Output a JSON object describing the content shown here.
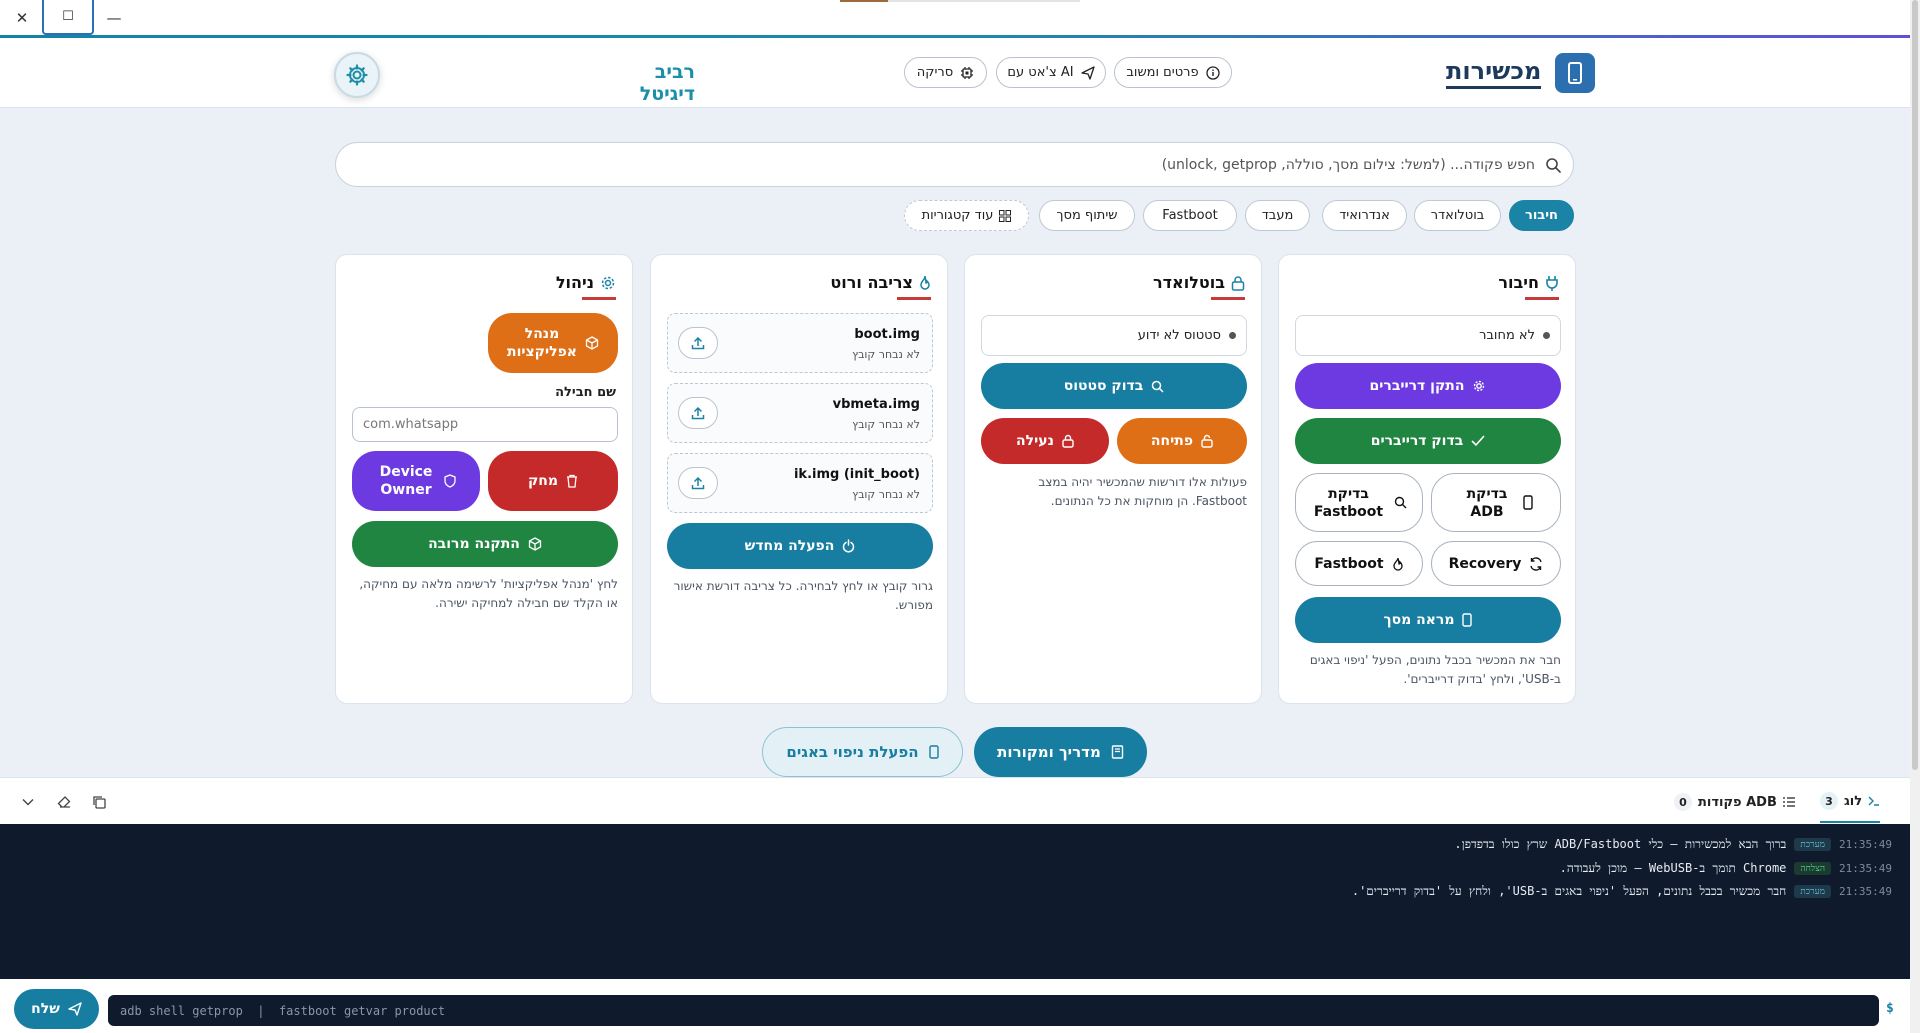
{
  "window": {
    "close": "✕",
    "maximize": "☐",
    "minimize": "—"
  },
  "header": {
    "app_name": "מכשירות",
    "nav": {
      "details": "פרטים ומשוב",
      "chat": "צ'אט עם AI",
      "scan": "סריקה"
    },
    "user_name": "רביב דיגיטל"
  },
  "search": {
    "placeholder": "חפש פקודה... (למשל: צילום מסך, סוללה, unlock, getprop)"
  },
  "categories": {
    "connect": "חיבור",
    "bootloader": "בוטלואדר",
    "android": "אנדרואיד",
    "processor": "מעבד",
    "fastboot": "Fastboot",
    "screen_share": "שיתוף מסך",
    "more": "עוד קטגוריות"
  },
  "cards": {
    "connect": {
      "title": "חיבור",
      "status": "לא מחובר",
      "install_drivers": "התקן דרייברים",
      "check_drivers": "בדוק דרייברים",
      "check_adb": "בדיקת ADB",
      "check_fastboot": "בדיקת Fastboot",
      "recovery": "Recovery",
      "fastboot": "Fastboot",
      "mirror": "מראה מסך",
      "note": "חבר את המכשיר בכבל נתונים, הפעל 'ניפוי באגים ב-USB', ולחץ 'בדוק דרייברים'."
    },
    "bootloader": {
      "title": "בוטלואדר",
      "status": "סטטוס לא ידוע",
      "check_status": "בדוק סטטוס",
      "unlock": "פתיחה",
      "lock": "נעילה",
      "note": "פעולות אלו דורשות שהמכשיר יהיה במצב Fastboot. הן מוחקות את כל הנתונים."
    },
    "flash": {
      "title": "צריבה ורוט",
      "files": [
        {
          "name": "boot.img",
          "status": "לא נבחר קובץ"
        },
        {
          "name": "vbmeta.img",
          "status": "לא נבחר קובץ"
        },
        {
          "name": "ik.img (init_boot)",
          "status": "לא נבחר קובץ"
        }
      ],
      "reboot": "הפעלה מחדש",
      "note": "גרור קובץ או לחץ לבחירה. כל צריבה דורשת אישור מפורש."
    },
    "manage": {
      "title": "ניהול",
      "app_manager": "מנהל אפליקציות",
      "package_label": "שם חבילה",
      "package_placeholder": "com.whatsapp",
      "remove": "מחק",
      "device_owner": "Device Owner",
      "bulk_install": "התקנה מרובה",
      "note": "לחץ 'מנהל אפליקציות' לרשימה מלאה עם מחיקה, או הקלד שם חבילה למחיקה ישירה."
    }
  },
  "bottom": {
    "guide": "מדריך ומקורות",
    "enable_debug": "הפעלת ניפוי באגים"
  },
  "panel": {
    "log_tab": "לוג",
    "log_count": "3",
    "adb_tab": "פקודות ADB",
    "adb_count": "0",
    "rows": [
      {
        "time": "21:35:49",
        "tag": "מערכת",
        "text": "ברוך הבא למכשירות — כלי ADB/Fastboot שרץ כולו בדפדפן."
      },
      {
        "time": "21:35:49",
        "tag": "הצלחה",
        "text": "Chrome תומך ב-WebUSB — מוכן לעבודה."
      },
      {
        "time": "21:35:49",
        "tag": "מערכת",
        "text": "חבר מכשיר בכבל נתונים, הפעל 'ניפוי באגים ב-USB', ולחץ על 'בדוק דרייברים'."
      }
    ]
  },
  "command": {
    "placeholder": "adb shell getprop  |  fastboot getvar product",
    "send": "שלח",
    "prompt": "$"
  },
  "colors": {
    "accent": "#177ea1",
    "purple": "#6c3ae0",
    "green": "#1f8541",
    "orange": "#df6f17",
    "red": "#c42a2a"
  }
}
